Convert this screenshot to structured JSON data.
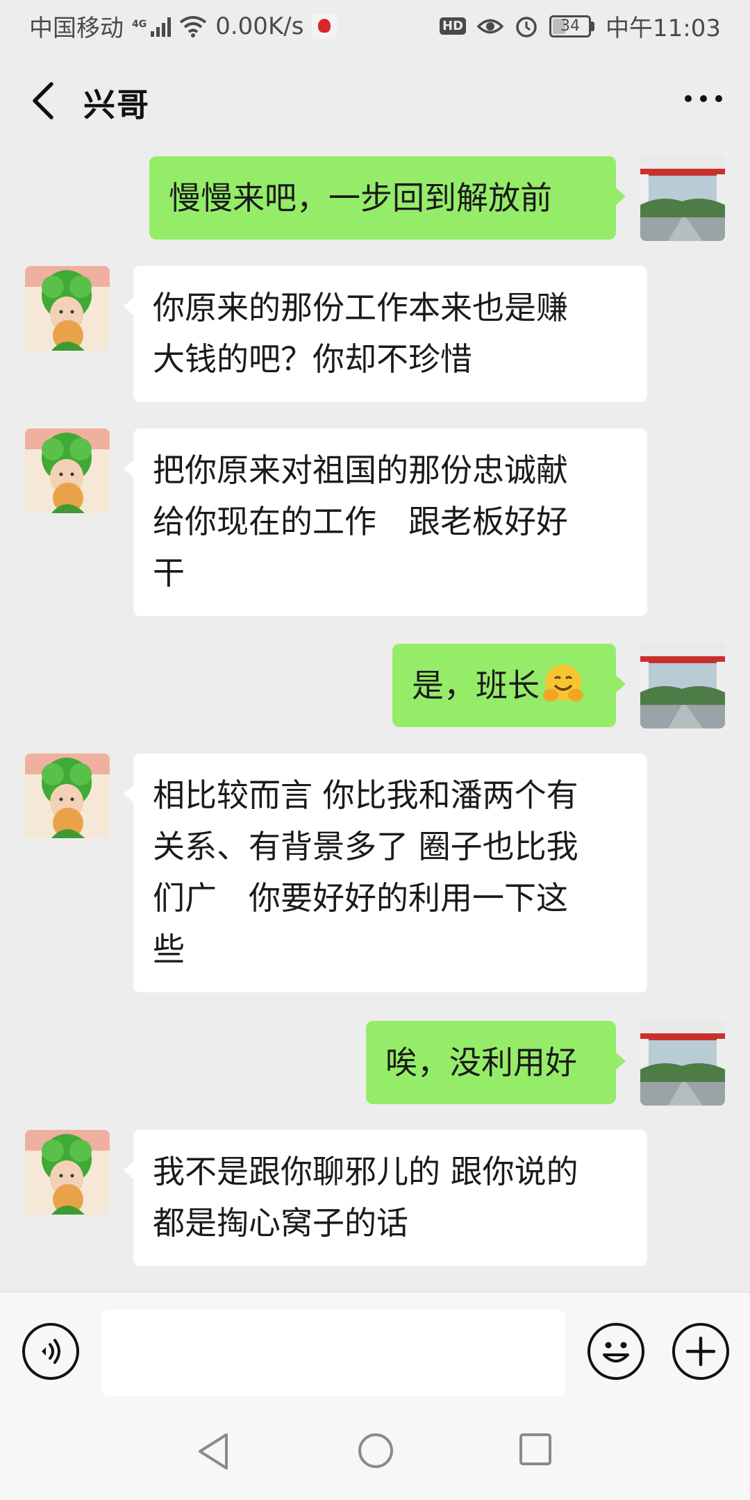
{
  "status_bar": {
    "carrier": "中国移动",
    "network": "4G",
    "speed": "0.00K/s",
    "hd": "HD",
    "battery": "34",
    "time": "中午11:03"
  },
  "header": {
    "title": "兴哥"
  },
  "messages": [
    {
      "side": "out",
      "text": "慢慢来吧，一步回到解放前"
    },
    {
      "side": "in",
      "lines": [
        "你原来的那份工作本来也是赚",
        "大钱的吧？你却不珍惜"
      ]
    },
    {
      "side": "in",
      "lines": [
        "把你原来对祖国的那份忠诚献",
        "给你现在的工作　跟老板好好",
        "干"
      ]
    },
    {
      "side": "out",
      "text": "是，班长",
      "emoji": "hugging-face-emoji"
    },
    {
      "side": "in",
      "lines": [
        "相比较而言 你比我和潘两个有",
        "关系、有背景多了 圈子也比我",
        "们广　你要好好的利用一下这",
        "些"
      ]
    },
    {
      "side": "out",
      "text": "唉，没利用好"
    },
    {
      "side": "in",
      "lines": [
        "我不是跟你聊邪儿的 跟你说的",
        "都是掏心窝子的话"
      ]
    }
  ],
  "input_bar": {
    "voice_icon": "voice-icon",
    "emoji_icon": "emoji-icon",
    "plus_icon": "plus-icon",
    "text_value": ""
  },
  "colors": {
    "background": "#ededed",
    "bubble_out": "#95ec69",
    "bubble_in": "#ffffff"
  }
}
